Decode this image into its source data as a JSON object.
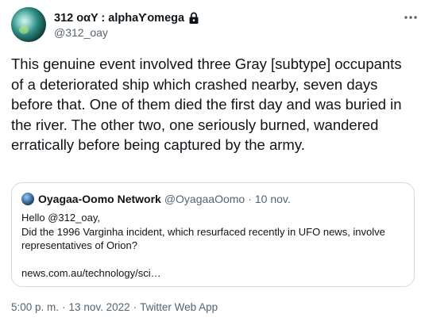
{
  "author": {
    "display_name": "312 οαY : alphaƳomega",
    "handle": "@312_oay",
    "protected": true
  },
  "tweet": {
    "text": "This genuine event involved three Gray [subtype] occupants of a deteriorated ship which crashed nearby, seven days before that. One of them died the first day and was buried in the river. The other two, one seriously burned, wandered erratically before being captured by the army."
  },
  "quoted": {
    "display_name": "Oyagaa-Oomo Network",
    "handle": "@OyagaaOomo",
    "separator": "·",
    "date": "10 nov.",
    "lines": [
      "Hello @312_oay,",
      "Did the 1996 Varginha incident, which resurfaced recently in UFO news, involve representatives of Orion?"
    ],
    "link": "news.com.au/technology/sci…"
  },
  "meta": {
    "time": "5:00 p. m.",
    "separator": "·",
    "date": "13 nov. 2022",
    "source": "Twitter Web App"
  },
  "icons": {
    "lock": "lock-icon",
    "more": "more-options-icon"
  },
  "colors": {
    "text": "#0f1419",
    "secondary": "#536471",
    "border": "#cfd9de"
  }
}
